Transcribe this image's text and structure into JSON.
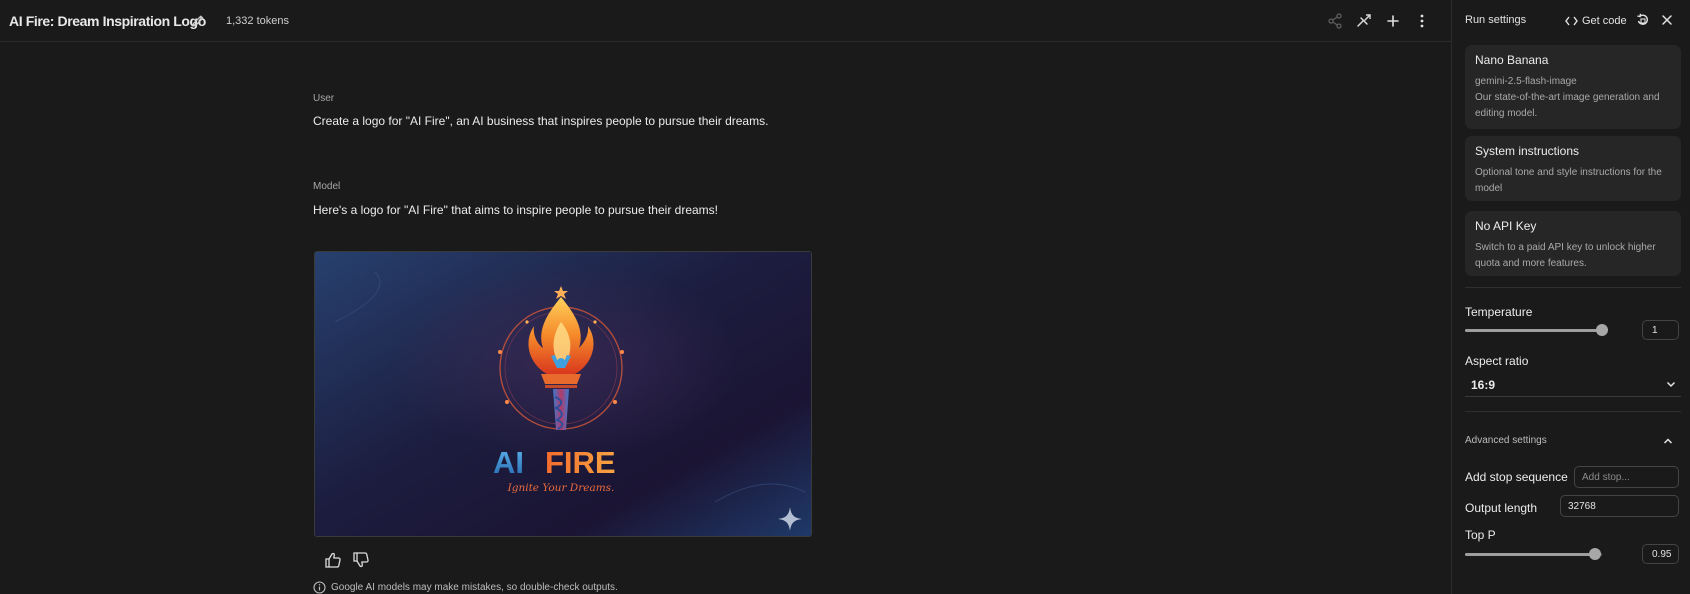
{
  "header": {
    "title": "AI Fire: Dream Inspiration Logo",
    "tokens": "1,332 tokens",
    "icons": [
      "edit-icon",
      "share-icon",
      "compare-icon",
      "add-icon",
      "more-icon"
    ]
  },
  "chat": {
    "user_role": "User",
    "user_message": "Create a logo for \"AI Fire\", an AI business that inspires people to pursue their dreams.",
    "model_role": "Model",
    "model_message": "Here's a logo for \"AI Fire\" that aims to inspire people to pursue their dreams!",
    "image": {
      "logo_text_ai": "AI",
      "logo_text_fire": "FIRE",
      "tagline": "Ignite Your Dreams."
    },
    "disclaimer": "Google AI models may make mistakes, so double-check outputs."
  },
  "panel": {
    "title": "Run settings",
    "get_code": "Get code",
    "model_card": {
      "title": "Nano Banana",
      "model_id": "gemini-2.5-flash-image",
      "description": "Our state-of-the-art image generation and editing model."
    },
    "system_card": {
      "title": "System instructions",
      "description": "Optional tone and style instructions for the model"
    },
    "api_card": {
      "title": "No API Key",
      "description": "Switch to a paid API key to unlock higher quota and more features."
    },
    "temperature": {
      "label": "Temperature",
      "value": "1",
      "level": 1.0
    },
    "aspect_ratio": {
      "label": "Aspect ratio",
      "value": "16:9"
    },
    "advanced": {
      "label": "Advanced settings",
      "expanded": true
    },
    "stop_sequence": {
      "label": "Add stop sequence",
      "placeholder": "Add stop..."
    },
    "output_length": {
      "label": "Output length",
      "value": "32768"
    },
    "top_p": {
      "label": "Top P",
      "value": "0.95",
      "level": 0.95
    }
  },
  "colors": {
    "background": "#1a1a1a",
    "card": "#262626",
    "text": "#e3e3e3",
    "muted": "#a9a9a9",
    "flame_orange": "#f58a2a",
    "logo_blue": "#3e9ad8"
  }
}
